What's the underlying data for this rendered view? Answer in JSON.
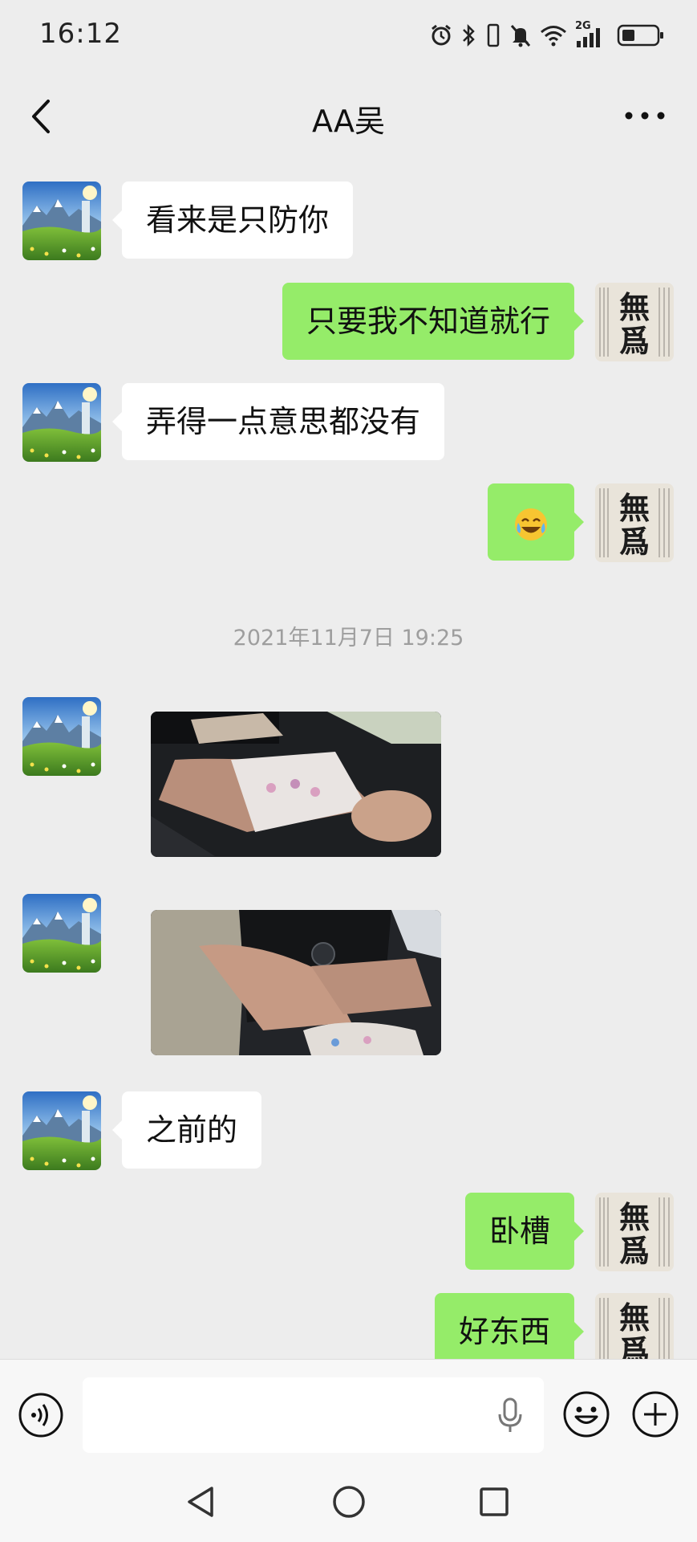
{
  "status_bar": {
    "time": "16:12",
    "network": "2G",
    "icons": [
      "alarm-icon",
      "bluetooth-icon",
      "vibrate-icon",
      "mute-icon",
      "wifi-icon",
      "signal-icon",
      "battery-icon"
    ]
  },
  "header": {
    "title": "AA吴",
    "back_icon": "chevron-left-icon",
    "more_icon": "more-dots-icon"
  },
  "messages": [
    {
      "side": "in",
      "type": "text",
      "text": "看来是只防你"
    },
    {
      "side": "out",
      "type": "text",
      "text": "只要我不知道就行"
    },
    {
      "side": "in",
      "type": "text",
      "text": "弄得一点意思都没有"
    },
    {
      "side": "out",
      "type": "emoji",
      "text": "😭"
    },
    {
      "side": "in",
      "type": "image",
      "description": "photo-car-interior-1"
    },
    {
      "side": "in",
      "type": "image",
      "description": "photo-car-interior-2"
    },
    {
      "side": "in",
      "type": "text",
      "text": "之前的"
    },
    {
      "side": "out",
      "type": "text",
      "text": "卧槽"
    },
    {
      "side": "out",
      "type": "text",
      "text": "好东西"
    }
  ],
  "timestamp": "2021年11月7日 19:25",
  "avatar_self_text": "無爲",
  "input_bar": {
    "placeholder": "",
    "value": ""
  },
  "colors": {
    "background": "#ededed",
    "bubble_out": "#95ec69",
    "bubble_in": "#ffffff",
    "timestamp": "#9e9e9e"
  }
}
